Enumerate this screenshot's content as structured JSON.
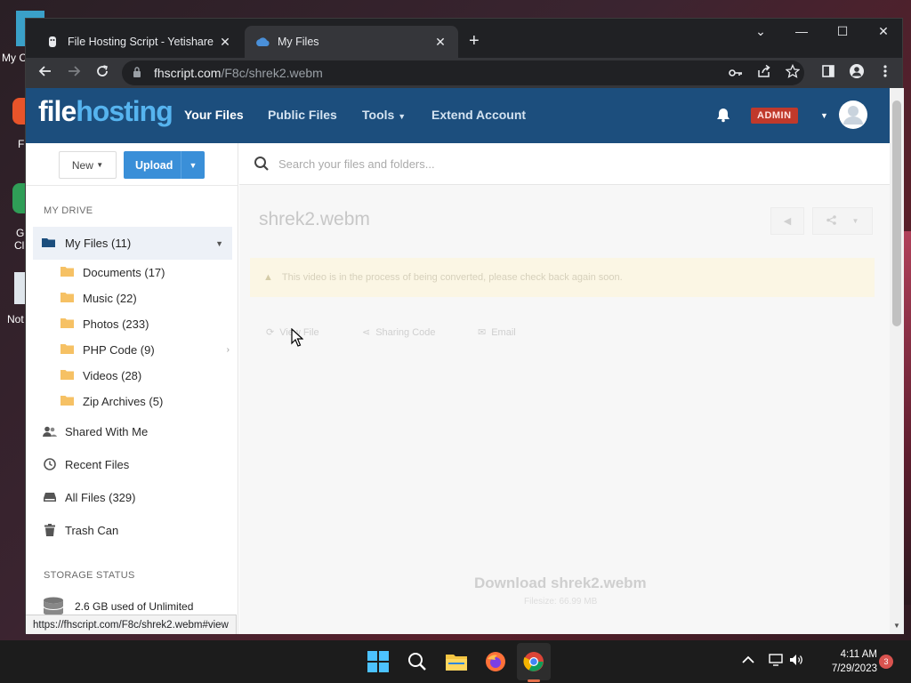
{
  "desktop": {
    "icon_labels": [
      "My C",
      "F",
      "G",
      "Cl",
      "Not"
    ]
  },
  "browser": {
    "tabs": [
      {
        "label": "File Hosting Script - Yetishare",
        "close": "✕"
      },
      {
        "label": "My Files",
        "close": "✕"
      }
    ],
    "new_tab": "+",
    "window_controls": {
      "menu": "⌄",
      "minimize": "—",
      "maximize": "☐",
      "close": "✕"
    },
    "url_host": "fhscript.com",
    "url_path": "/F8c/shrek2.webm",
    "status_url": "https://fhscript.com/F8c/shrek2.webm#view"
  },
  "site": {
    "logo_part1": "file",
    "logo_part2": "hosting",
    "nav": {
      "your_files": "Your Files",
      "public_files": "Public Files",
      "tools": "Tools",
      "extend_account": "Extend Account"
    },
    "admin_badge": "ADMIN"
  },
  "sidebar": {
    "new_label": "New",
    "upload_label": "Upload",
    "my_drive_heading": "MY DRIVE",
    "my_files": "My Files (11)",
    "folders": [
      {
        "label": "Documents (17)",
        "has_children": false
      },
      {
        "label": "Music (22)",
        "has_children": false
      },
      {
        "label": "Photos (233)",
        "has_children": false
      },
      {
        "label": "PHP Code (9)",
        "has_children": true
      },
      {
        "label": "Videos (28)",
        "has_children": false
      },
      {
        "label": "Zip Archives (5)",
        "has_children": false
      }
    ],
    "links": {
      "shared": "Shared With Me",
      "recent": "Recent Files",
      "all": "All Files (329)",
      "trash": "Trash Can"
    },
    "storage_heading": "STORAGE STATUS",
    "storage_text": "2.6 GB used of Unlimited"
  },
  "main": {
    "search_placeholder": "Search your files and folders...",
    "file_title": "shrek2.webm",
    "notice": "This video is in the process of being converted, please check back again soon.",
    "actions": {
      "view": "View File",
      "sharing": "Sharing Code",
      "email": "Email"
    },
    "download_title": "Download shrek2.webm",
    "download_size": "Filesize: 66.99 MB"
  },
  "taskbar": {
    "time": "4:11 AM",
    "date": "7/29/2023",
    "notification_count": "3"
  },
  "colors": {
    "header_blue": "#1c4e7d",
    "logo_accent": "#56b4ef",
    "upload_blue": "#3a8fd8",
    "admin_red": "#c0392b",
    "chrome_dark": "#202124"
  }
}
